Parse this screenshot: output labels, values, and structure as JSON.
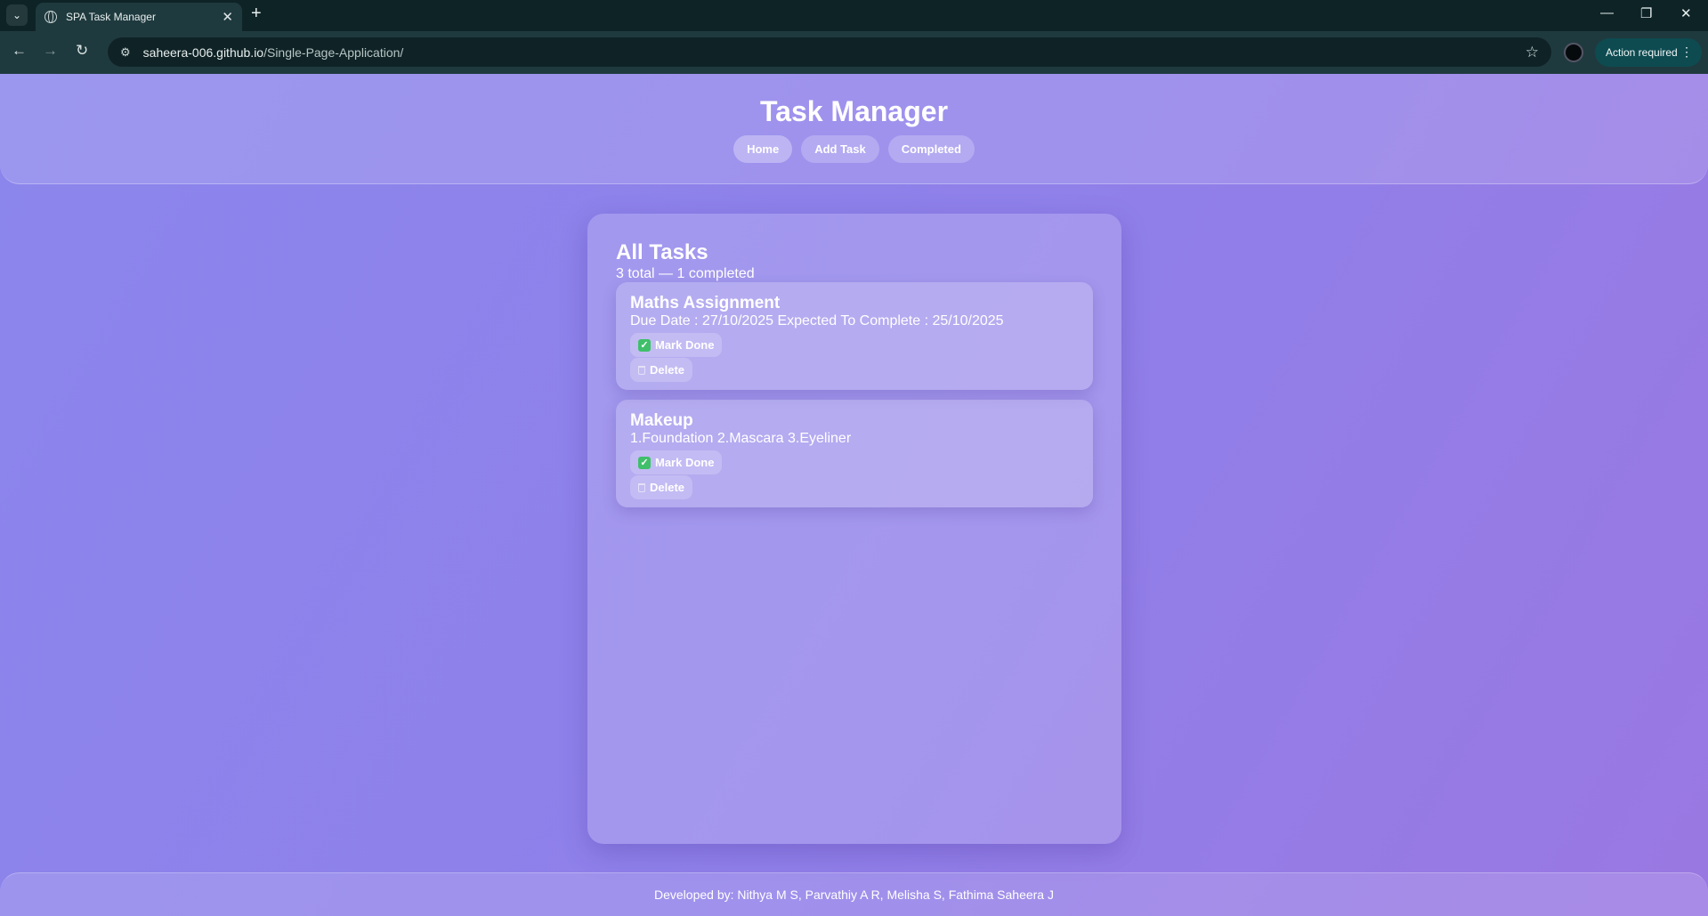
{
  "browser": {
    "tab_title": "SPA Task Manager",
    "url_host": "saheera-006.github.io",
    "url_path": "/Single-Page-Application/",
    "action_chip": "Action required"
  },
  "header": {
    "title": "Task Manager",
    "nav": [
      "Home",
      "Add Task",
      "Completed"
    ]
  },
  "main": {
    "heading": "All Tasks",
    "summary": "3 total — 1 completed",
    "tasks": [
      {
        "title": "Maths Assignment",
        "description": "Due Date : 27/10/2025 Expected To Complete : 25/10/2025",
        "done_label": "Mark Done",
        "delete_label": "Delete"
      },
      {
        "title": "Makeup",
        "description": "1.Foundation 2.Mascara 3.Eyeliner",
        "done_label": "Mark Done",
        "delete_label": "Delete"
      }
    ]
  },
  "footer": {
    "text": "Developed by: Nithya M S, Parvathiy A R, Melisha S, Fathima Saheera J"
  },
  "colors": {
    "check": "#3fbf6a",
    "chrome_bg": "#0e2326",
    "page_bg": "#8f80ea"
  }
}
